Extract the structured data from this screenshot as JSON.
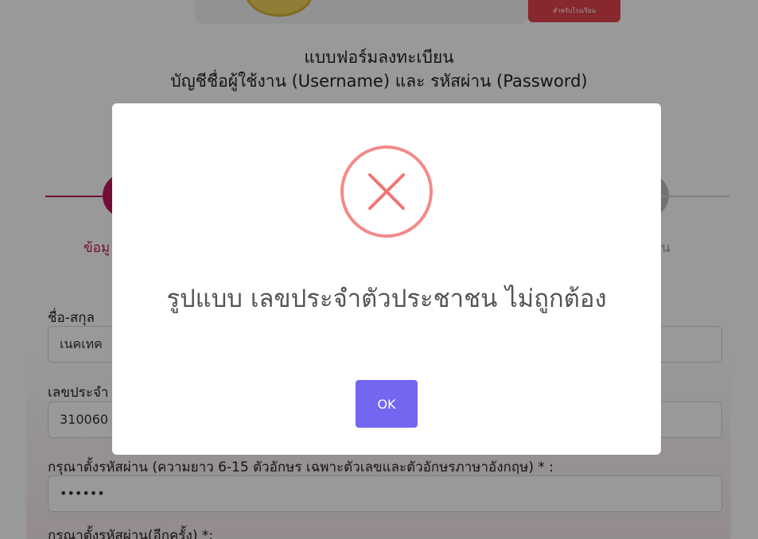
{
  "header": {
    "school_button_label": "สำหรับโรงเรียน",
    "form_title": "แบบฟอร์มลงทะเบียน",
    "form_subtitle": "บัญชีชื่อผู้ใช้งาน (Username) และ รหัสผ่าน (Password)"
  },
  "stepper": {
    "step1_label": "ข้อมู",
    "step3_label": "น",
    "active_color": "#c2185b",
    "inactive_color": "#bdbdbd"
  },
  "form": {
    "name_label": "ชื่อ-สกุล",
    "name_value": "เนคเทค",
    "id_label": "เลขประจำ",
    "id_value": "310060",
    "password_label": "กรุณาตั้งรหัสผ่าน (ความยาว 6-15 ตัวอักษร เฉพาะตัวเลขและตัวอักษรภาษาอังกฤษ) * :",
    "password_value": "••••••",
    "confirm_label": "กรุณาตั้งรหัสผ่าน(อีกครั้ง) *:"
  },
  "modal": {
    "icon": "error-x-icon",
    "icon_color": "#f27474",
    "message": "รูปแบบ เลขประจำตัวประชาชน ไม่ถูกต้อง",
    "ok_label": "OK",
    "ok_color": "#7367f0"
  }
}
